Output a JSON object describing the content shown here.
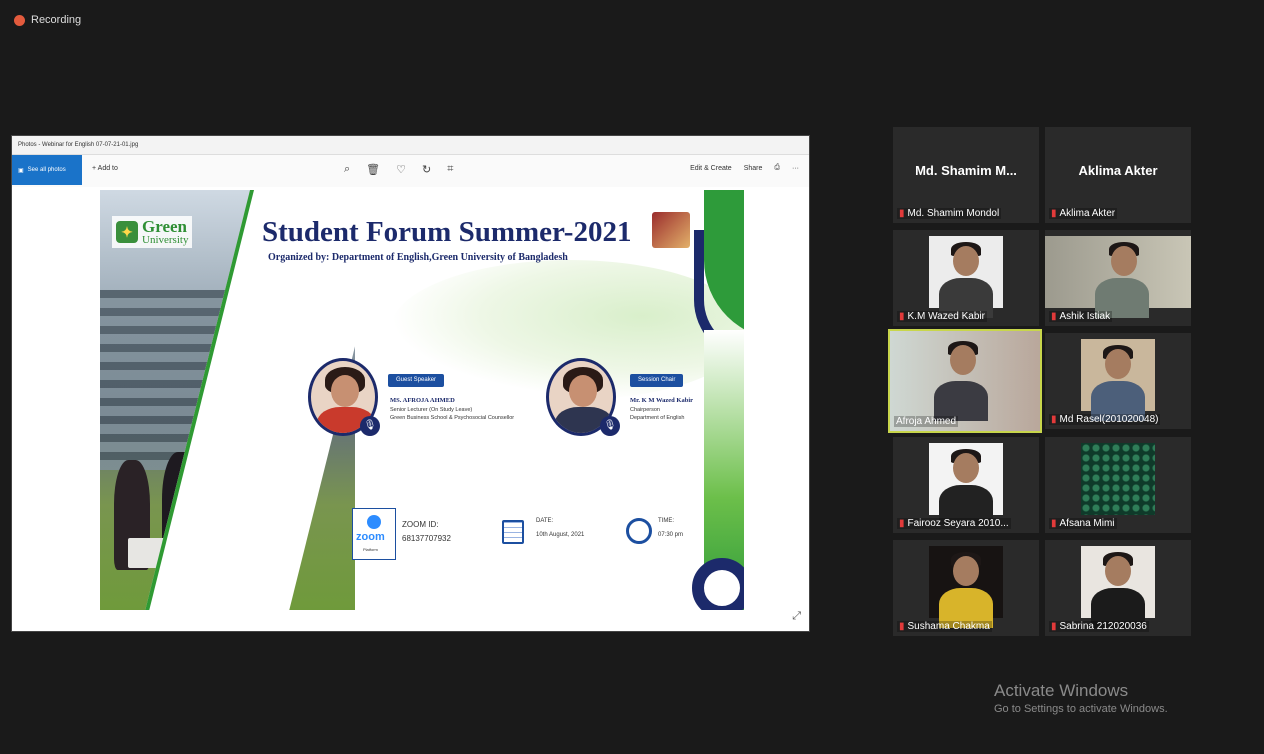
{
  "recording": {
    "label": "Recording"
  },
  "share_window": {
    "title": "Photos - Webinar for English 07-07-21-01.jpg",
    "see_all": "See all photos",
    "add_to": "+ Add to",
    "edit_create": "Edit & Create",
    "share": "Share",
    "more": "···"
  },
  "slide": {
    "logo_line1": "Green",
    "logo_line2": "University",
    "title": "Student Forum Summer-2021",
    "organized": "Organized by: Department of English,Green University of Bangladesh",
    "guest_tag": "Guest Speaker",
    "guest_name": "MS. AFROJA AHMED",
    "guest_line1": "Senior Lecturer (On Study Leave)",
    "guest_line2": "Green Business School & Psychosocial Counsellor",
    "chair_tag": "Session Chair",
    "chair_name": "Mr. K M Wazed Kabir",
    "chair_line1": "Chairperson",
    "chair_line2": "Department of English",
    "zoom_word": "zoom",
    "zoom_sub": "Platform",
    "zoom_id_label": "ZOOM ID:",
    "zoom_id_value": "68137707932",
    "date_label": "DATE:",
    "date_value": "10th August, 2021",
    "time_label": "TIME:",
    "time_value": "07:30 pm"
  },
  "participants": [
    {
      "display": "Md. Shamim M...",
      "label": "Md. Shamim Mondol",
      "video": false
    },
    {
      "display": "Aklima Akter",
      "label": "Aklima Akter",
      "video": false
    },
    {
      "label": "K.M Wazed Kabir",
      "video": true
    },
    {
      "label": "Ashik Istiak",
      "video": true
    },
    {
      "label": "Afroja Ahmed",
      "video": true,
      "active": true
    },
    {
      "label": "Md Rasel(201020048)",
      "video": true
    },
    {
      "label": "Fairooz Seyara 2010...",
      "video": true
    },
    {
      "label": "Afsana Mimi",
      "video": true
    },
    {
      "label": "Sushama Chakma",
      "video": true
    },
    {
      "label": "Sabrina 212020036",
      "video": true
    }
  ],
  "watermark": {
    "line1": "Activate Windows",
    "line2": "Go to Settings to activate Windows."
  },
  "colors": {
    "accent": "#1c2a6b",
    "green": "#2f9a33",
    "active_border": "#c8d64b",
    "mute": "#e23a3a"
  }
}
